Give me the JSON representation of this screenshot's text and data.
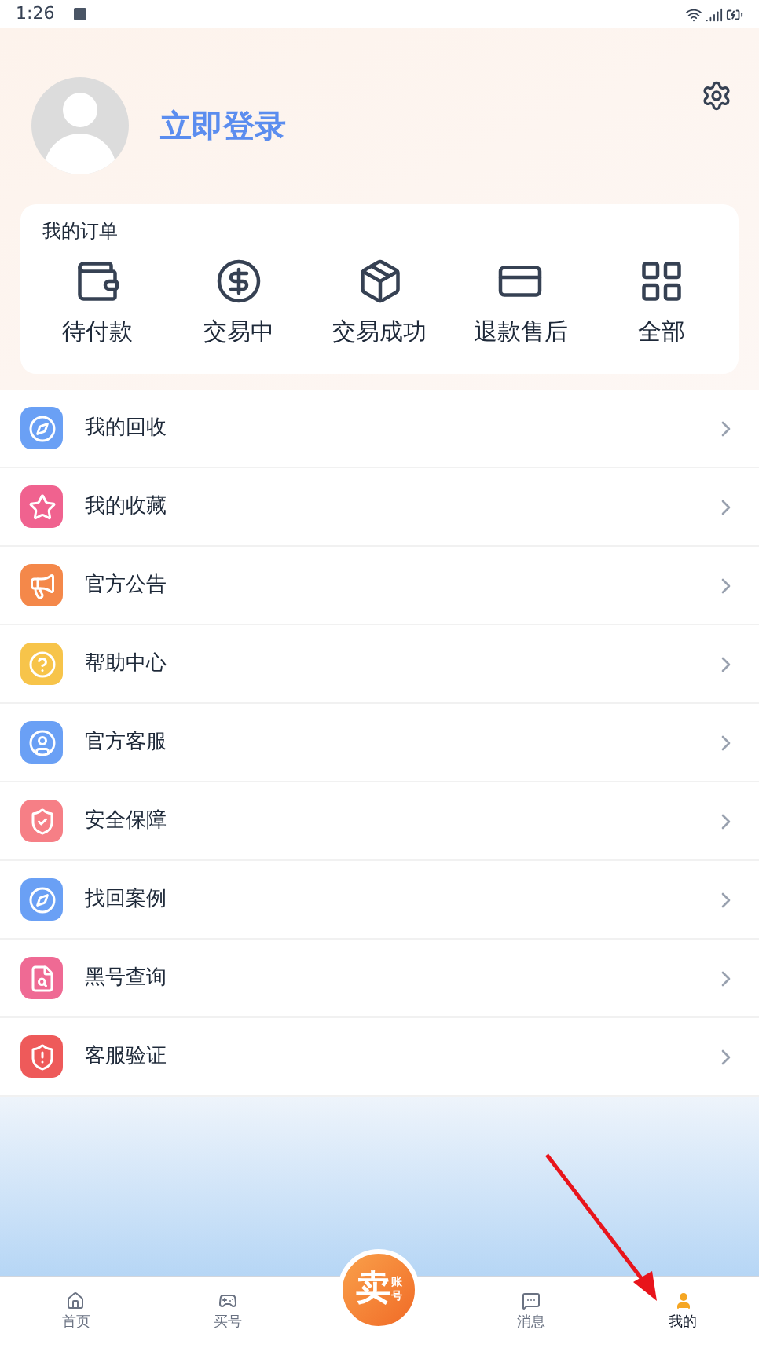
{
  "status_bar": {
    "time": "1:26"
  },
  "profile": {
    "login": "立即登录"
  },
  "orders": {
    "title": "我的订单",
    "items": [
      {
        "label": "待付款"
      },
      {
        "label": "交易中"
      },
      {
        "label": "交易成功"
      },
      {
        "label": "退款售后"
      },
      {
        "label": "全部"
      }
    ]
  },
  "menu": [
    {
      "label": "我的回收",
      "color": "#6aa0f5"
    },
    {
      "label": "我的收藏",
      "color": "#f0628f"
    },
    {
      "label": "官方公告",
      "color": "#f4884a"
    },
    {
      "label": "帮助中心",
      "color": "#f7c44a"
    },
    {
      "label": "官方客服",
      "color": "#6aa0f5"
    },
    {
      "label": "安全保障",
      "color": "#f67f86"
    },
    {
      "label": "找回案例",
      "color": "#6aa0f5"
    },
    {
      "label": "黑号查询",
      "color": "#ef6a94"
    },
    {
      "label": "客服验证",
      "color": "#ee5a5a"
    }
  ],
  "nav": [
    {
      "kind": "tab",
      "label": "首页",
      "selected": false
    },
    {
      "kind": "tab",
      "label": "买号",
      "selected": false
    },
    {
      "kind": "center",
      "label": "卖",
      "sub": "账号",
      "selected": false
    },
    {
      "kind": "tab",
      "label": "消息",
      "selected": false
    },
    {
      "kind": "tab",
      "label": "我的",
      "selected": true
    }
  ]
}
